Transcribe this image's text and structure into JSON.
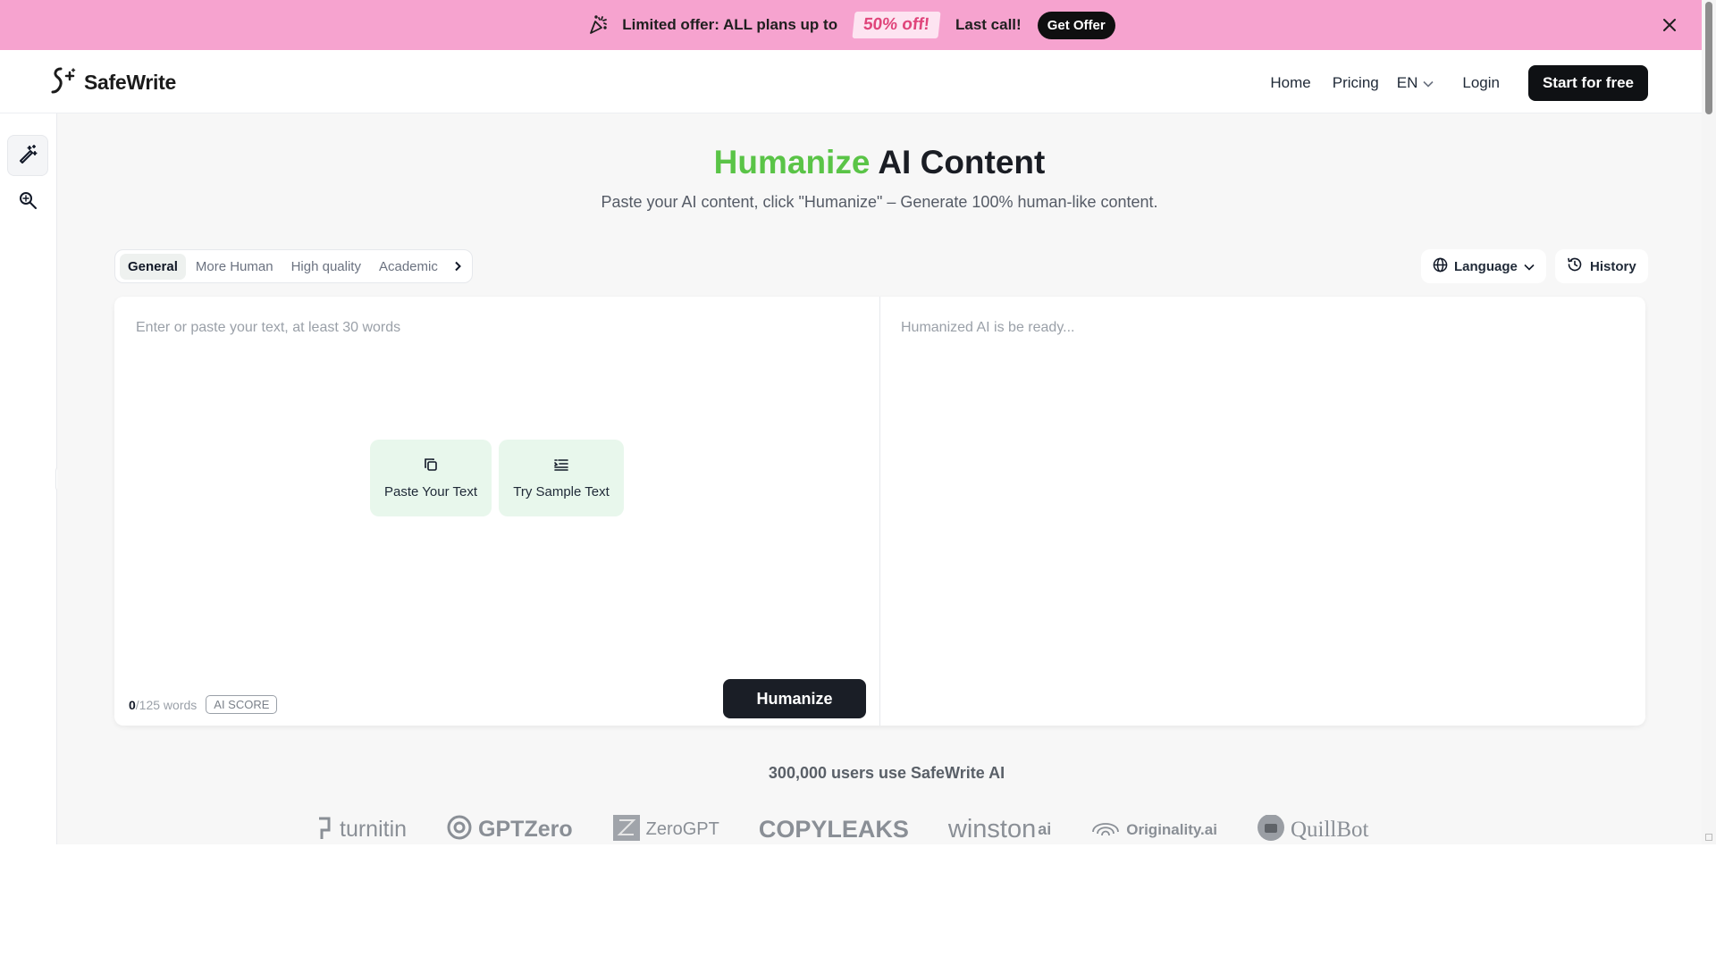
{
  "promo": {
    "text": "Limited offer: ALL plans up to",
    "badge": "50% off!",
    "last_call": "Last call!",
    "button": "Get Offer",
    "color": "#f6a3cf"
  },
  "header": {
    "logo": "SafeWrite",
    "nav": [
      "Home",
      "Pricing"
    ],
    "language": "EN",
    "login": "Login",
    "cta": "Start for free"
  },
  "sidebar": {
    "items": [
      {
        "icon": "magic-pen-icon",
        "active": true
      },
      {
        "icon": "search-ai-icon",
        "active": false
      }
    ]
  },
  "hero": {
    "title_accent": "Humanize",
    "title_rest": " AI Content",
    "subtitle": "Paste your AI content, click \"Humanize\" – Generate 100% human-like content.",
    "accent_color": "#5ac447"
  },
  "modes": [
    "General",
    "More Human",
    "High quality",
    "Academic"
  ],
  "controls": {
    "language": "Language",
    "history": "History"
  },
  "editor": {
    "input_placeholder": "Enter or paste your text, at least 30 words",
    "output_placeholder": "Humanized AI is be ready...",
    "paste_label": "Paste Your Text",
    "sample_label": "Try Sample Text",
    "word_count": "0",
    "word_limit": "/125 words",
    "ai_score": "AI SCORE",
    "humanize": "Humanize"
  },
  "social_proof": {
    "text": "300,000 users use SafeWrite AI",
    "brands": [
      "turnitin",
      "GPTZero",
      "ZeroGPT",
      "COPYLEAKS",
      "winston",
      "ai",
      "Originality.ai",
      "QuillBot"
    ]
  }
}
